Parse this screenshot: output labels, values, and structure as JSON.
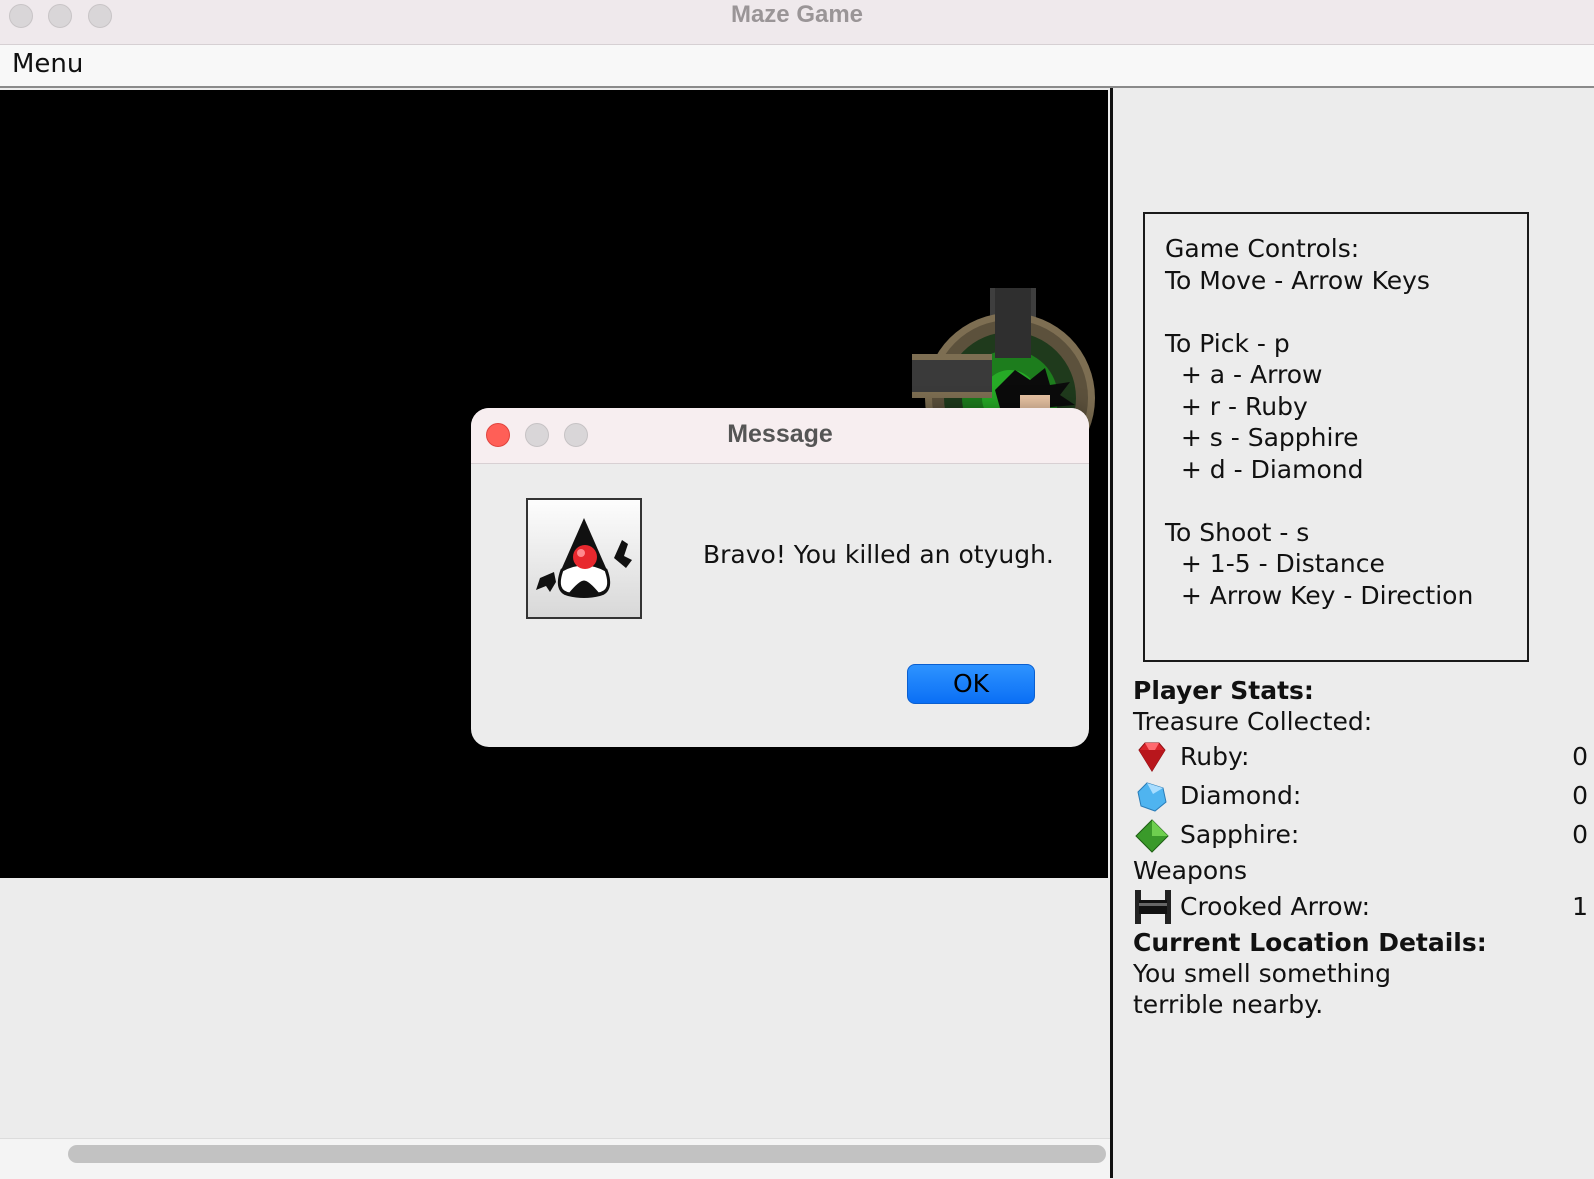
{
  "window": {
    "title": "Maze Game"
  },
  "menubar": {
    "menu_label": "Menu"
  },
  "controls": {
    "lines": [
      "Game Controls:",
      "To Move - Arrow Keys",
      "To Pick - p",
      "  + a - Arrow",
      "  + r - Ruby",
      "  + s - Sapphire",
      "  + d - Diamond",
      "To Shoot - s",
      "  + 1-5 - Distance",
      "  + Arrow Key - Direction"
    ]
  },
  "stats": {
    "heading": "Player Stats:",
    "treasure_heading": "Treasure Collected:",
    "ruby_label": "Ruby:",
    "ruby_value": "0",
    "diamond_label": "Diamond:",
    "diamond_value": "0",
    "sapphire_label": "Sapphire:",
    "sapphire_value": "0",
    "weapons_heading": "Weapons",
    "arrow_label": "Crooked Arrow:",
    "arrow_value": "1",
    "location_heading": "Current Location Details:",
    "location_line1": "You smell something",
    "location_line2": "terrible nearby."
  },
  "dialog": {
    "title": "Message",
    "message": "Bravo! You killed an otyugh.",
    "ok_label": "OK",
    "icon": "java-duke-icon"
  },
  "colors": {
    "close_red": "#ff5f57",
    "ok_blue": "#0a6ff5",
    "canvas_bg": "#000000",
    "ruby": "#d8232a",
    "diamond": "#4fb4f0",
    "sapphire": "#3a9a2a"
  }
}
